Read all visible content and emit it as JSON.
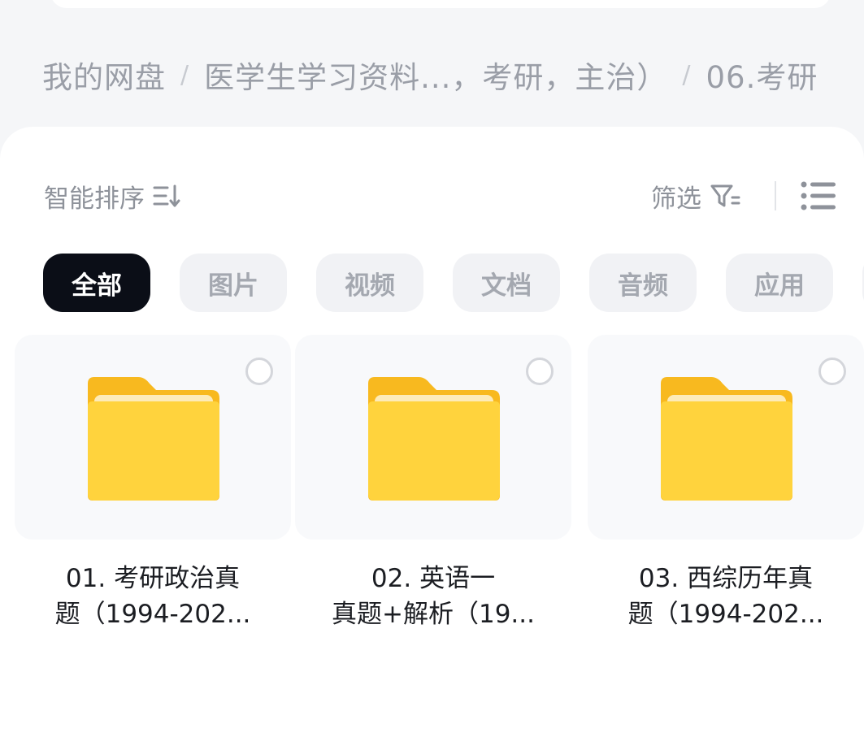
{
  "breadcrumb": {
    "items": [
      "我的网盘",
      "医学生学习资料...，考研，主治）",
      "06.考研"
    ],
    "separator": "/"
  },
  "toolbar": {
    "sort_label": "智能排序",
    "filter_label": "筛选"
  },
  "categories": [
    "全部",
    "图片",
    "视频",
    "文档",
    "音频",
    "应用"
  ],
  "active_category": "全部",
  "files": [
    {
      "line1": "01. 考研政治真",
      "line2": "题（1994-202..."
    },
    {
      "line1": "02. 英语一",
      "line2": "真题+解析（19..."
    },
    {
      "line1": "03. 西综历年真",
      "line2": "题（1994-202..."
    }
  ],
  "icons": {
    "sort": "sort-icon",
    "filter": "filter-icon",
    "view": "list-view-icon",
    "folder": "folder-icon",
    "select": "radio-icon"
  },
  "colors": {
    "folder": "#ffc92b",
    "active_chip": "#0b0e17",
    "chip": "#f1f2f5"
  }
}
